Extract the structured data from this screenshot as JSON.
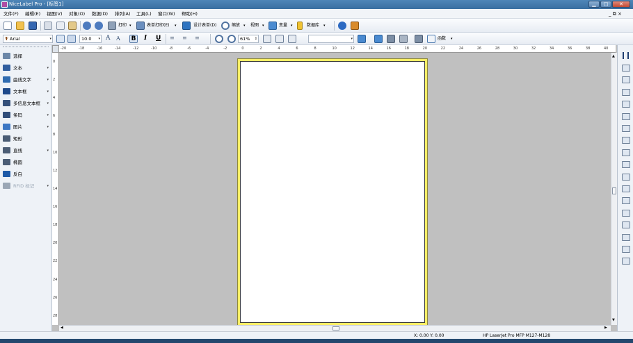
{
  "window": {
    "title": "NiceLabel Pro - [标签1]",
    "min_glyph": "▁",
    "max_glyph": "□",
    "close_glyph": "✕"
  },
  "menu": [
    "文件(F)",
    "编辑(E)",
    "视图(V)",
    "对象(O)",
    "数据(D)",
    "排列(A)",
    "工具(L)",
    "窗口(W)",
    "帮助(H)"
  ],
  "mdi_controls": "_ ⧉ ×",
  "toolbar1": {
    "print_label": "打印",
    "form_print_label": "表单打印(E)",
    "design_form_label": "设计表单(D)",
    "zoom_label": "缩放",
    "view_label": "视图",
    "variable_label": "变量",
    "database_label": "数据库"
  },
  "toolbar2": {
    "font_name": "Arial",
    "font_size": "10.0",
    "zoom_value": "61%",
    "functions_label": "函数"
  },
  "tools": [
    {
      "label": "选择",
      "has_arrow": false,
      "color": "#6c87a8"
    },
    {
      "label": "文本",
      "has_arrow": true,
      "color": "#2f5d9e"
    },
    {
      "label": "曲线文字",
      "has_arrow": true,
      "color": "#2f6bb0"
    },
    {
      "label": "文本框",
      "has_arrow": true,
      "color": "#1f4a8a"
    },
    {
      "label": "多信息文本框",
      "has_arrow": true,
      "color": "#34507a"
    },
    {
      "label": "条码",
      "has_arrow": true,
      "color": "#304d7a"
    },
    {
      "label": "图片",
      "has_arrow": true,
      "color": "#3c77c4"
    },
    {
      "label": "矩形",
      "has_arrow": false,
      "color": "#4a5c75"
    },
    {
      "label": "直线",
      "has_arrow": true,
      "color": "#4a5c75"
    },
    {
      "label": "椭圆",
      "has_arrow": false,
      "color": "#4a5c75"
    },
    {
      "label": "反白",
      "has_arrow": false,
      "color": "#1e5aa8"
    },
    {
      "label": "RFID 标记",
      "has_arrow": true,
      "color": "#9aa6b5",
      "disabled": true
    }
  ],
  "ruler_h_ticks": [
    "-20",
    "-18",
    "-16",
    "-14",
    "-12",
    "-10",
    "-8",
    "-6",
    "-4",
    "-2",
    "0",
    "2",
    "4",
    "6",
    "8",
    "10",
    "12",
    "14",
    "16",
    "18",
    "20",
    "22",
    "24",
    "26",
    "28",
    "30",
    "32",
    "34",
    "36",
    "38",
    "40"
  ],
  "ruler_v_ticks": [
    "0",
    "2",
    "4",
    "6",
    "8",
    "10",
    "12",
    "14",
    "16",
    "18",
    "20",
    "22",
    "24",
    "26",
    "28"
  ],
  "status": {
    "coordinates": "X: 0.00 Y: 0.00",
    "printer": "HP LaserJet Pro MFP M127-M128"
  },
  "colors": {
    "label_border": "#ffee66",
    "canvas_bg": "#c0c0c0",
    "title_bar": "#3a6fa1"
  }
}
